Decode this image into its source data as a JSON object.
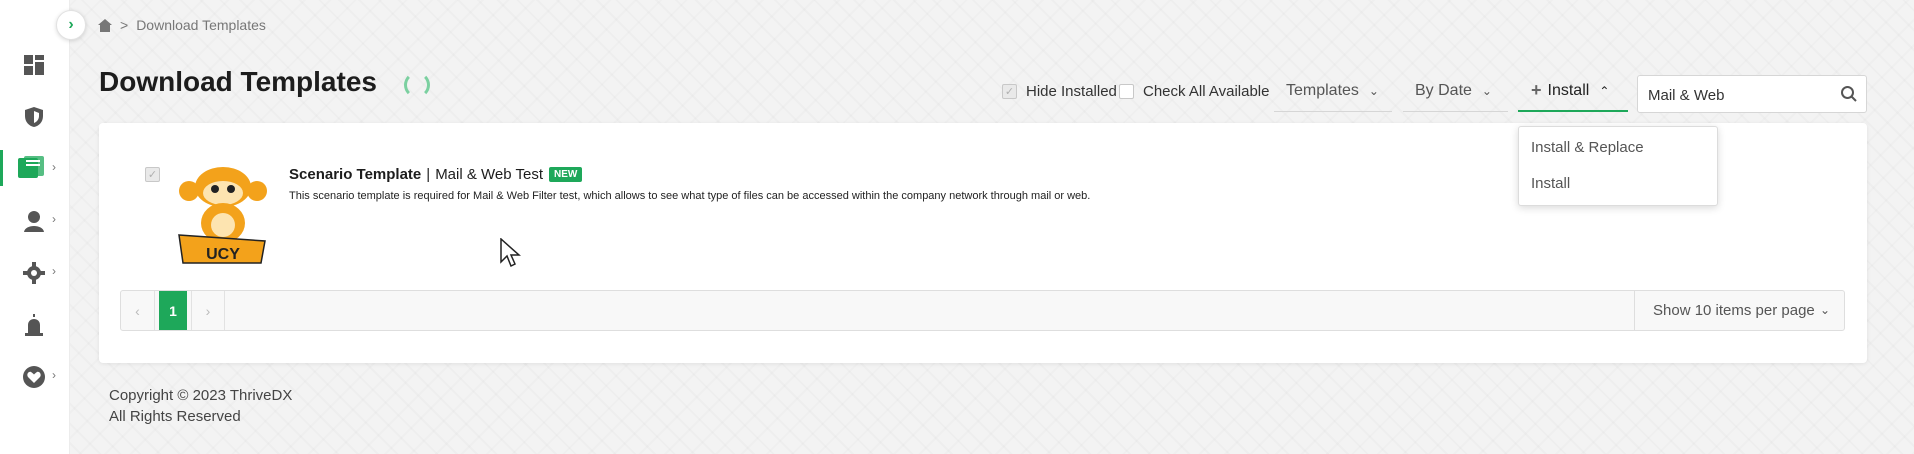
{
  "breadcrumb": {
    "home_icon": "home-icon",
    "separator": ">",
    "current": "Download Templates"
  },
  "page": {
    "title": "Download Templates"
  },
  "filters": {
    "hide_installed": {
      "label": "Hide Installed",
      "checked": true
    },
    "check_all": {
      "label": "Check All Available",
      "checked": false
    },
    "templates_label": "Templates",
    "by_date_label": "By Date",
    "install_label": "Install"
  },
  "search": {
    "value": "Mail & Web",
    "icon": "search-icon"
  },
  "install_menu": {
    "items": [
      "Install & Replace",
      "Install"
    ]
  },
  "template": {
    "name": "Scenario Template",
    "subtitle": "Mail & Web Test",
    "badge": "NEW",
    "description": "This scenario template is required for Mail & Web Filter test, which allows to see what type of files can be accessed within the company network through mail or web.",
    "logo_text": "UCY"
  },
  "pagination": {
    "prev": "‹",
    "current_page": "1",
    "next": "›",
    "per_page": "Show 10 items per page"
  },
  "footer": {
    "copyright": "Copyright © 2023 ThriveDX",
    "rights": "All Rights Reserved"
  },
  "sidebar": {
    "items": [
      {
        "icon": "dashboard-icon"
      },
      {
        "icon": "shield-icon"
      },
      {
        "icon": "templates-icon",
        "active": true
      },
      {
        "icon": "user-icon"
      },
      {
        "icon": "gear-icon"
      },
      {
        "icon": "alarm-icon"
      },
      {
        "icon": "heart-icon"
      }
    ]
  },
  "colors": {
    "accent": "#1ea85a",
    "text_dark": "#1d1d1d"
  }
}
